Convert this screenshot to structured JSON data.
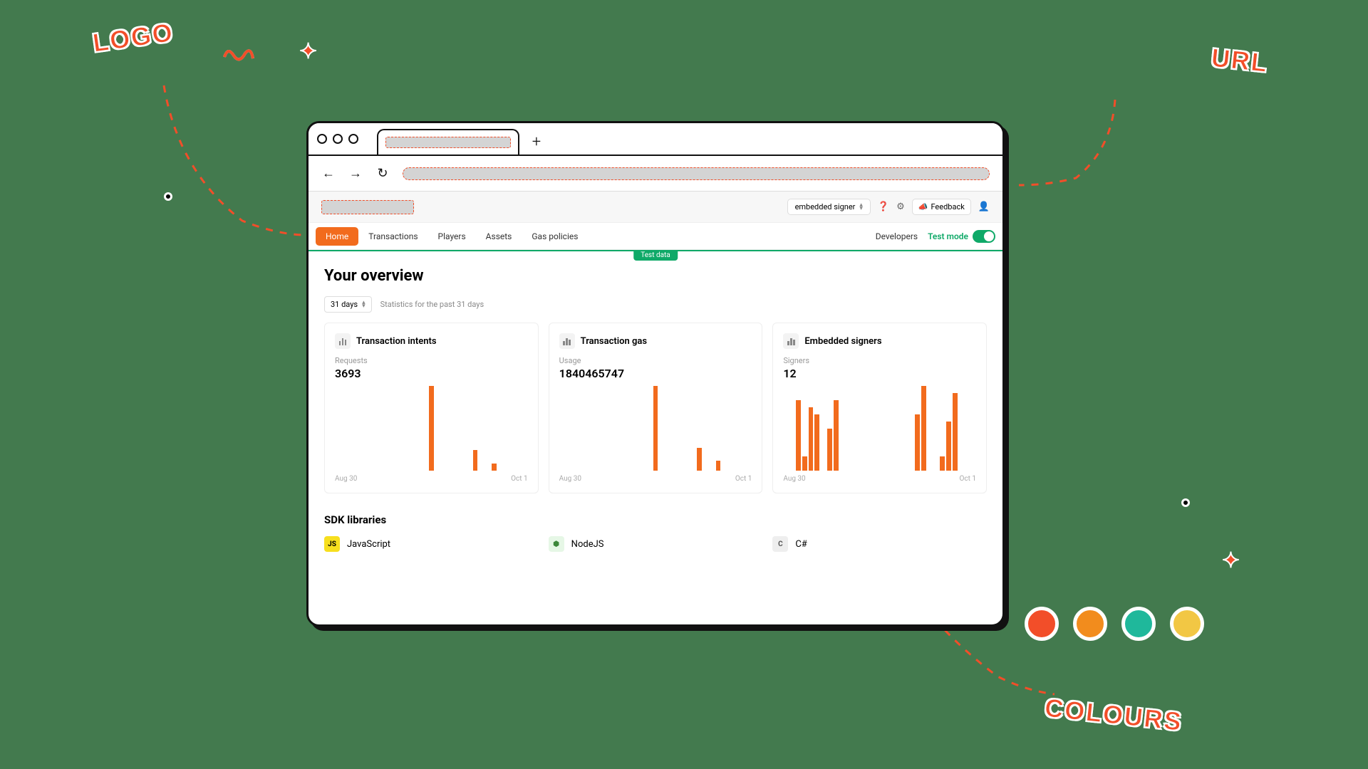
{
  "annotations": {
    "logo": "LOGO",
    "url": "URL",
    "colours": "COLOURS"
  },
  "header": {
    "signer_select": "embedded signer",
    "feedback_label": "Feedback"
  },
  "nav": {
    "tabs": [
      "Home",
      "Transactions",
      "Players",
      "Assets",
      "Gas policies"
    ],
    "developers_label": "Developers",
    "testmode_label": "Test mode"
  },
  "ribbon": {
    "test_data": "Test data"
  },
  "page": {
    "title": "Your overview",
    "days_value": "31 days",
    "days_desc": "Statistics for the past 31 days"
  },
  "cards": [
    {
      "title": "Transaction intents",
      "subtitle": "Requests",
      "value": "3693",
      "x_start": "Aug 30",
      "x_end": "Oct 1"
    },
    {
      "title": "Transaction gas",
      "subtitle": "Usage",
      "value": "1840465747",
      "x_start": "Aug 30",
      "x_end": "Oct 1"
    },
    {
      "title": "Embedded signers",
      "subtitle": "Signers",
      "value": "12",
      "x_start": "Aug 30",
      "x_end": "Oct 1"
    }
  ],
  "sdk": {
    "title": "SDK libraries",
    "items": [
      {
        "name": "JavaScript",
        "icon": "JS"
      },
      {
        "name": "NodeJS",
        "icon": "⬢"
      },
      {
        "name": "C#",
        "icon": "C"
      }
    ]
  },
  "colours": [
    "#f24e29",
    "#f28c1d",
    "#1fb89b",
    "#f2c744"
  ],
  "chart_data": [
    {
      "type": "bar",
      "title": "Transaction intents — Requests",
      "x_start": "Aug 30",
      "x_end": "Oct 1",
      "values": [
        0,
        0,
        0,
        0,
        0,
        0,
        0,
        0,
        0,
        0,
        0,
        0,
        0,
        0,
        0,
        3693,
        0,
        0,
        0,
        0,
        0,
        0,
        900,
        0,
        0,
        300,
        0,
        0,
        0,
        0,
        0
      ]
    },
    {
      "type": "bar",
      "title": "Transaction gas — Usage",
      "x_start": "Aug 30",
      "x_end": "Oct 1",
      "values": [
        0,
        0,
        0,
        0,
        0,
        0,
        0,
        0,
        0,
        0,
        0,
        0,
        0,
        0,
        0,
        1840465747,
        0,
        0,
        0,
        0,
        0,
        0,
        500000000,
        0,
        0,
        220000000,
        0,
        0,
        0,
        0,
        0
      ]
    },
    {
      "type": "bar",
      "title": "Embedded signers — Signers",
      "x_start": "Aug 30",
      "x_end": "Oct 1",
      "values": [
        0,
        0,
        10,
        2,
        9,
        8,
        0,
        6,
        10,
        0,
        0,
        0,
        0,
        0,
        0,
        0,
        0,
        0,
        0,
        0,
        0,
        8,
        12,
        0,
        0,
        2,
        7,
        11,
        0,
        0,
        0
      ]
    }
  ]
}
